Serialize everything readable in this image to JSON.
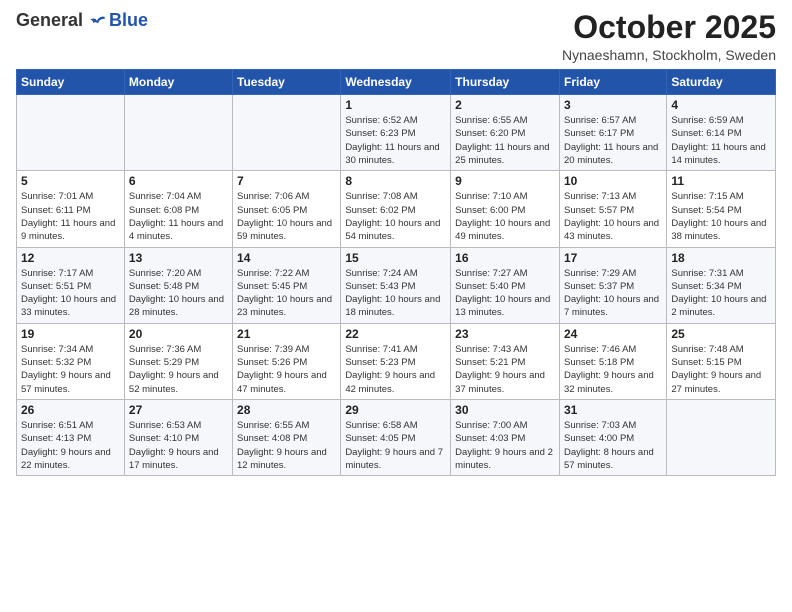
{
  "header": {
    "logo_general": "General",
    "logo_blue": "Blue",
    "month": "October 2025",
    "location": "Nynaeshamn, Stockholm, Sweden"
  },
  "weekdays": [
    "Sunday",
    "Monday",
    "Tuesday",
    "Wednesday",
    "Thursday",
    "Friday",
    "Saturday"
  ],
  "weeks": [
    [
      {
        "day": "",
        "info": ""
      },
      {
        "day": "",
        "info": ""
      },
      {
        "day": "",
        "info": ""
      },
      {
        "day": "1",
        "info": "Sunrise: 6:52 AM\nSunset: 6:23 PM\nDaylight: 11 hours\nand 30 minutes."
      },
      {
        "day": "2",
        "info": "Sunrise: 6:55 AM\nSunset: 6:20 PM\nDaylight: 11 hours\nand 25 minutes."
      },
      {
        "day": "3",
        "info": "Sunrise: 6:57 AM\nSunset: 6:17 PM\nDaylight: 11 hours\nand 20 minutes."
      },
      {
        "day": "4",
        "info": "Sunrise: 6:59 AM\nSunset: 6:14 PM\nDaylight: 11 hours\nand 14 minutes."
      }
    ],
    [
      {
        "day": "5",
        "info": "Sunrise: 7:01 AM\nSunset: 6:11 PM\nDaylight: 11 hours\nand 9 minutes."
      },
      {
        "day": "6",
        "info": "Sunrise: 7:04 AM\nSunset: 6:08 PM\nDaylight: 11 hours\nand 4 minutes."
      },
      {
        "day": "7",
        "info": "Sunrise: 7:06 AM\nSunset: 6:05 PM\nDaylight: 10 hours\nand 59 minutes."
      },
      {
        "day": "8",
        "info": "Sunrise: 7:08 AM\nSunset: 6:02 PM\nDaylight: 10 hours\nand 54 minutes."
      },
      {
        "day": "9",
        "info": "Sunrise: 7:10 AM\nSunset: 6:00 PM\nDaylight: 10 hours\nand 49 minutes."
      },
      {
        "day": "10",
        "info": "Sunrise: 7:13 AM\nSunset: 5:57 PM\nDaylight: 10 hours\nand 43 minutes."
      },
      {
        "day": "11",
        "info": "Sunrise: 7:15 AM\nSunset: 5:54 PM\nDaylight: 10 hours\nand 38 minutes."
      }
    ],
    [
      {
        "day": "12",
        "info": "Sunrise: 7:17 AM\nSunset: 5:51 PM\nDaylight: 10 hours\nand 33 minutes."
      },
      {
        "day": "13",
        "info": "Sunrise: 7:20 AM\nSunset: 5:48 PM\nDaylight: 10 hours\nand 28 minutes."
      },
      {
        "day": "14",
        "info": "Sunrise: 7:22 AM\nSunset: 5:45 PM\nDaylight: 10 hours\nand 23 minutes."
      },
      {
        "day": "15",
        "info": "Sunrise: 7:24 AM\nSunset: 5:43 PM\nDaylight: 10 hours\nand 18 minutes."
      },
      {
        "day": "16",
        "info": "Sunrise: 7:27 AM\nSunset: 5:40 PM\nDaylight: 10 hours\nand 13 minutes."
      },
      {
        "day": "17",
        "info": "Sunrise: 7:29 AM\nSunset: 5:37 PM\nDaylight: 10 hours\nand 7 minutes."
      },
      {
        "day": "18",
        "info": "Sunrise: 7:31 AM\nSunset: 5:34 PM\nDaylight: 10 hours\nand 2 minutes."
      }
    ],
    [
      {
        "day": "19",
        "info": "Sunrise: 7:34 AM\nSunset: 5:32 PM\nDaylight: 9 hours\nand 57 minutes."
      },
      {
        "day": "20",
        "info": "Sunrise: 7:36 AM\nSunset: 5:29 PM\nDaylight: 9 hours\nand 52 minutes."
      },
      {
        "day": "21",
        "info": "Sunrise: 7:39 AM\nSunset: 5:26 PM\nDaylight: 9 hours\nand 47 minutes."
      },
      {
        "day": "22",
        "info": "Sunrise: 7:41 AM\nSunset: 5:23 PM\nDaylight: 9 hours\nand 42 minutes."
      },
      {
        "day": "23",
        "info": "Sunrise: 7:43 AM\nSunset: 5:21 PM\nDaylight: 9 hours\nand 37 minutes."
      },
      {
        "day": "24",
        "info": "Sunrise: 7:46 AM\nSunset: 5:18 PM\nDaylight: 9 hours\nand 32 minutes."
      },
      {
        "day": "25",
        "info": "Sunrise: 7:48 AM\nSunset: 5:15 PM\nDaylight: 9 hours\nand 27 minutes."
      }
    ],
    [
      {
        "day": "26",
        "info": "Sunrise: 6:51 AM\nSunset: 4:13 PM\nDaylight: 9 hours\nand 22 minutes."
      },
      {
        "day": "27",
        "info": "Sunrise: 6:53 AM\nSunset: 4:10 PM\nDaylight: 9 hours\nand 17 minutes."
      },
      {
        "day": "28",
        "info": "Sunrise: 6:55 AM\nSunset: 4:08 PM\nDaylight: 9 hours\nand 12 minutes."
      },
      {
        "day": "29",
        "info": "Sunrise: 6:58 AM\nSunset: 4:05 PM\nDaylight: 9 hours\nand 7 minutes."
      },
      {
        "day": "30",
        "info": "Sunrise: 7:00 AM\nSunset: 4:03 PM\nDaylight: 9 hours\nand 2 minutes."
      },
      {
        "day": "31",
        "info": "Sunrise: 7:03 AM\nSunset: 4:00 PM\nDaylight: 8 hours\nand 57 minutes."
      },
      {
        "day": "",
        "info": ""
      }
    ]
  ]
}
